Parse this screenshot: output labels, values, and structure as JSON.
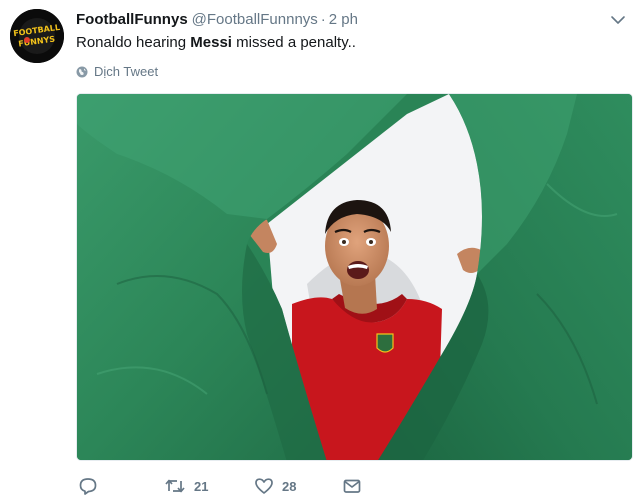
{
  "author": {
    "display_name": "FootballFunnys",
    "handle": "@FootballFunnnys",
    "separator": "·",
    "timestamp": "2 ph",
    "avatar_icon": "football-funnys-logo",
    "avatar_logo_text": [
      "FOOTBALL",
      "FUNNYS"
    ]
  },
  "tweet": {
    "text_before": "Ronaldo hearing ",
    "text_bold": "Messi",
    "text_after": " missed a penalty..",
    "translate_label": "Dịch Tweet",
    "translate_icon": "globe-icon",
    "media_alt": "Ronaldo tearing through green paper"
  },
  "actions": {
    "reply": {
      "icon": "reply-icon",
      "count": ""
    },
    "retweet": {
      "icon": "retweet-icon",
      "count": "21"
    },
    "like": {
      "icon": "heart-icon",
      "count": "28"
    },
    "dm": {
      "icon": "envelope-icon",
      "count": ""
    }
  },
  "colors": {
    "text": "#14171a",
    "secondary": "#657786",
    "paper_green": "#2e8a5c",
    "paper_green_dark": "#1f6b45",
    "shirt_red": "#c8161d",
    "backdrop": "#f3f4f6"
  }
}
